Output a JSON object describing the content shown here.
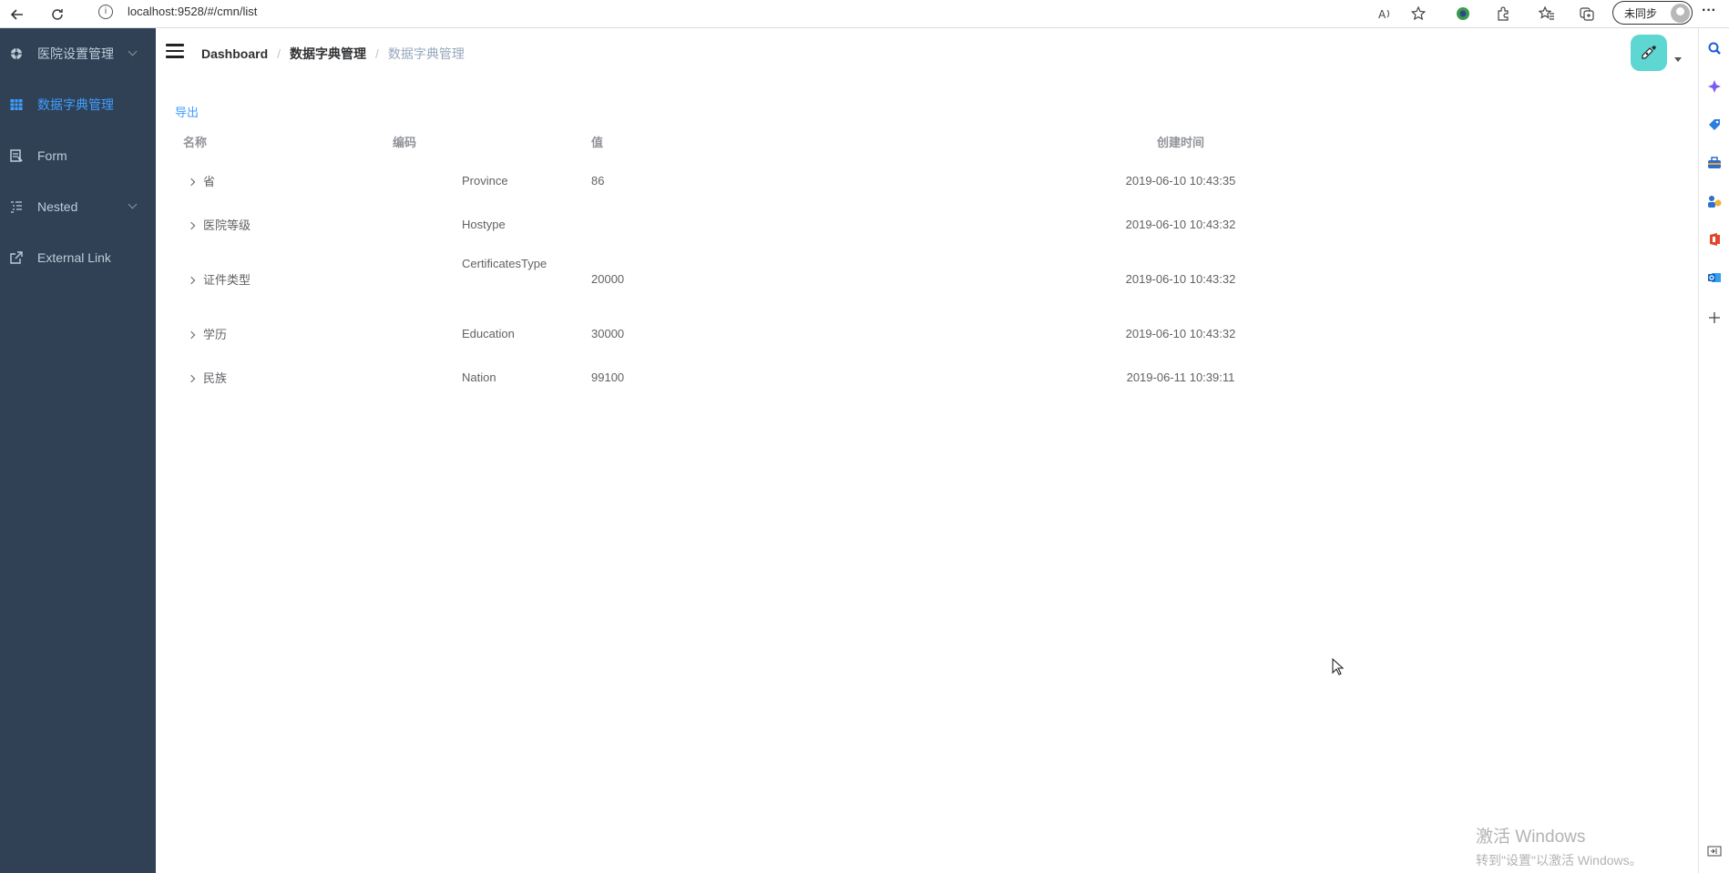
{
  "browser": {
    "url": "localhost:9528/#/cmn/list",
    "sync_label": "未同步",
    "more": "···"
  },
  "sidebar": {
    "items": [
      {
        "label": "医院设置管理",
        "icon": "settings-icon",
        "has_submenu": true
      },
      {
        "label": "数据字典管理",
        "icon": "table-icon",
        "active": true
      },
      {
        "label": "Form",
        "icon": "form-icon"
      },
      {
        "label": "Nested",
        "icon": "nested-icon",
        "has_submenu": true
      },
      {
        "label": "External Link",
        "icon": "external-link-icon"
      }
    ],
    "bg_color": "#304156",
    "text_color": "#bfcbd9",
    "active_color": "#409eff"
  },
  "navbar": {
    "breadcrumb": [
      "Dashboard",
      "数据字典管理",
      "数据字典管理"
    ]
  },
  "toolbar": {
    "export_label": "导出"
  },
  "table": {
    "headers": {
      "name": "名称",
      "code": "编码",
      "value": "值",
      "create_time": "创建时间"
    },
    "rows": [
      {
        "name": "省",
        "code": "Province",
        "value": "86",
        "create_time": "2019-06-10 10:43:35"
      },
      {
        "name": "医院等级",
        "code": "Hostype",
        "value": "",
        "create_time": "2019-06-10 10:43:32"
      },
      {
        "name": "证件类型",
        "code": "CertificatesType",
        "value": "20000",
        "create_time": "2019-06-10 10:43:32"
      },
      {
        "name": "学历",
        "code": "Education",
        "value": "30000",
        "create_time": "2019-06-10 10:43:32"
      },
      {
        "name": "民族",
        "code": "Nation",
        "value": "99100",
        "create_time": "2019-06-11 10:39:11"
      }
    ]
  },
  "watermark": {
    "line1": "激活 Windows",
    "line2": "转到\"设置\"以激活 Windows。"
  }
}
